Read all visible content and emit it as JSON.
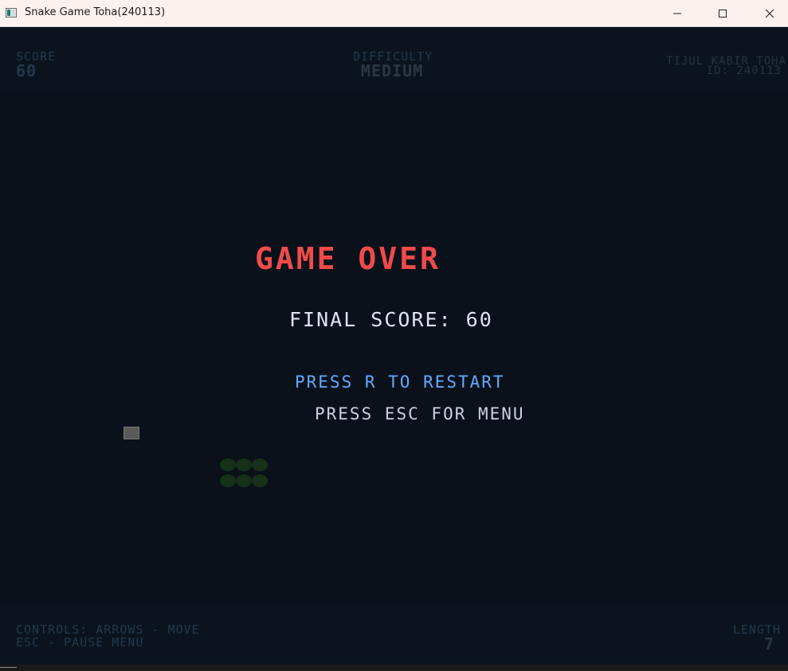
{
  "window": {
    "title": "Snake Game Toha(240113)",
    "icons": {
      "app": "app-window-icon",
      "minimize": "minimize-icon",
      "maximize": "maximize-icon",
      "close": "close-icon"
    }
  },
  "hud": {
    "score_label": "SCORE",
    "score_value": "60",
    "difficulty_label": "DIFFICULTY",
    "difficulty_value": "MEDIUM",
    "author_name": "TIJUL KABIR TOHA",
    "author_id": "ID: 240113"
  },
  "overlay": {
    "title": "GAME OVER",
    "final_score": "FINAL SCORE: 60",
    "restart_hint": "PRESS R TO RESTART",
    "menu_hint": "PRESS ESC FOR MENU"
  },
  "footer": {
    "controls_line1": "CONTROLS: ARROWS - MOVE",
    "controls_line2": "ESC - PAUSE MENU",
    "length_label": "LENGTH",
    "length_value": "7"
  },
  "board": {
    "food": "food-block",
    "snake_length": 7,
    "colors": {
      "background": "#0a111a",
      "hud": "#0b141e",
      "snake": "#163019",
      "food": "#5a5a5a",
      "game_over": "#f04a4a",
      "restart": "#63aaff"
    }
  }
}
